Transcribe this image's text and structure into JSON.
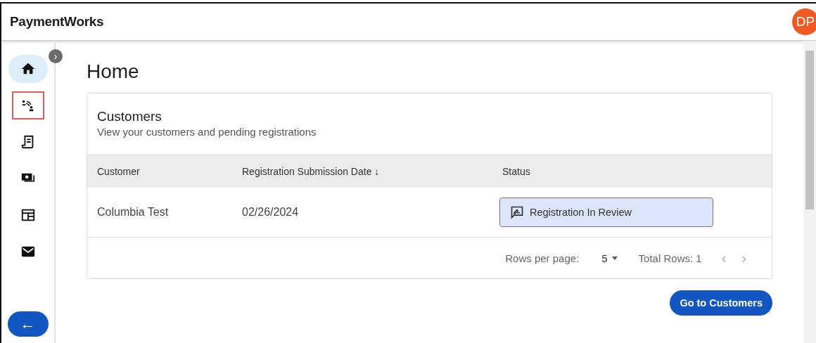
{
  "header": {
    "logo": "PaymentWorks",
    "avatar": "DP"
  },
  "sidebar": {
    "items": [
      {
        "kind": "home",
        "selected": true,
        "outlined": false
      },
      {
        "kind": "handshake",
        "selected": false,
        "outlined": true
      },
      {
        "kind": "receipt",
        "selected": false,
        "outlined": false
      },
      {
        "kind": "payments",
        "selected": false,
        "outlined": false
      },
      {
        "kind": "table",
        "selected": false,
        "outlined": false
      },
      {
        "kind": "mail",
        "selected": false,
        "outlined": false
      }
    ],
    "expand": "›",
    "back": "←"
  },
  "page": {
    "title": "Home"
  },
  "card": {
    "title": "Customers",
    "subtitle": "View your customers and pending registrations",
    "table": {
      "columns": [
        {
          "label": "Customer"
        },
        {
          "label": "Registration Submission Date",
          "sort": "↓"
        },
        {
          "label": "Status"
        }
      ],
      "rows": [
        {
          "customer": "Columbia Test",
          "date": "02/26/2024",
          "status": "Registration In Review"
        }
      ]
    },
    "pagination": {
      "rows_label": "Rows per page:",
      "rows_value": "5",
      "total": "Total Rows: 1",
      "prev": "‹",
      "next": "›"
    }
  },
  "action": {
    "label": "Go to Customers"
  }
}
